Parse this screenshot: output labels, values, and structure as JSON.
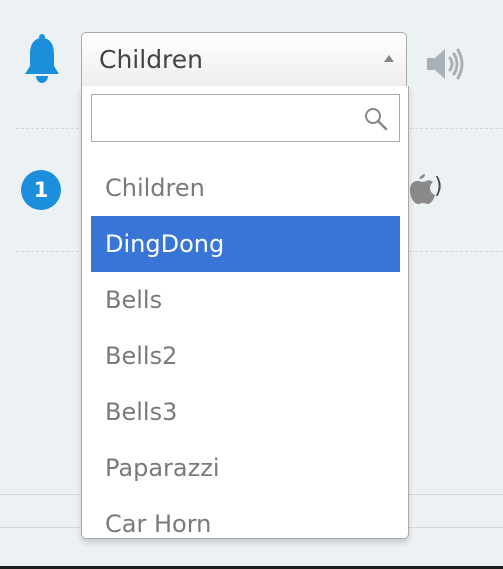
{
  "select": {
    "selected_label": "Children",
    "search_placeholder": "",
    "options": [
      {
        "label": "Children",
        "highlighted": false
      },
      {
        "label": "DingDong",
        "highlighted": true
      },
      {
        "label": "Bells",
        "highlighted": false
      },
      {
        "label": "Bells2",
        "highlighted": false
      },
      {
        "label": "Bells3",
        "highlighted": false
      },
      {
        "label": "Paparazzi",
        "highlighted": false
      },
      {
        "label": "Car Horn",
        "highlighted": false
      }
    ]
  },
  "row2": {
    "badge_number": "1",
    "trailing_text": ")"
  },
  "icons": {
    "bell": "bell-icon",
    "speaker": "speaker-icon",
    "apple": "apple-icon",
    "search": "search-icon",
    "arrow": "chevron-up-icon"
  },
  "colors": {
    "accent": "#1c8fdc",
    "highlight": "#3875d7",
    "background": "#ecf1f4"
  }
}
